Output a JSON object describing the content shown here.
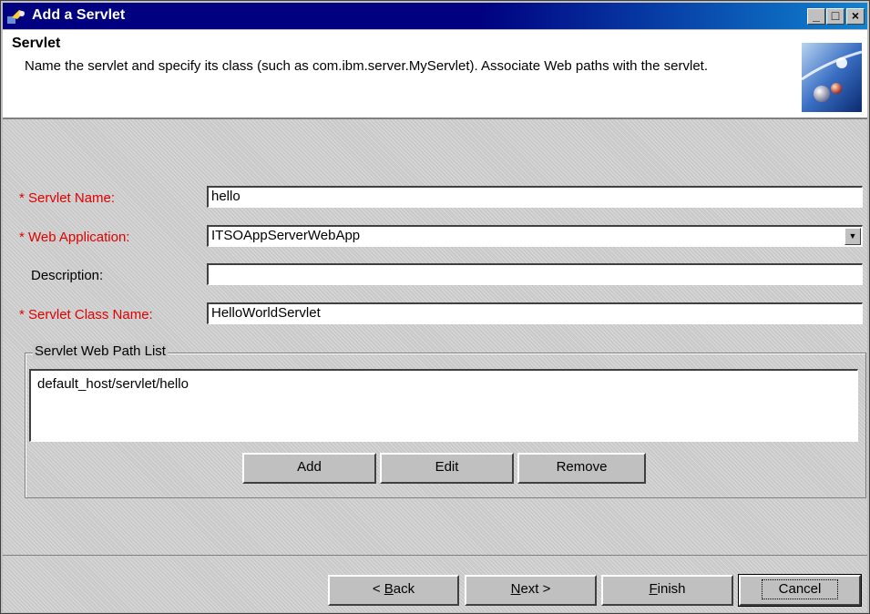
{
  "window": {
    "title": "Add a Servlet",
    "controls": {
      "minimize": "_",
      "maximize": "□",
      "close": "×"
    }
  },
  "header": {
    "title": "Servlet",
    "description": "Name the servlet and specify its class (such as com.ibm.server.MyServlet). Associate Web paths with the servlet."
  },
  "form": {
    "servlet_name": {
      "required_mark": "*",
      "label": "Servlet Name:",
      "value": "hello"
    },
    "web_application": {
      "required_mark": "*",
      "label": "Web Application:",
      "value": "ITSOAppServerWebApp"
    },
    "description": {
      "label": "Description:",
      "value": ""
    },
    "servlet_class": {
      "required_mark": "*",
      "label": "Servlet Class Name:",
      "value": "HelloWorldServlet"
    }
  },
  "web_path_list": {
    "legend": "Servlet Web Path List",
    "items": [
      "default_host/servlet/hello"
    ],
    "buttons": {
      "add": "Add",
      "edit": "Edit",
      "remove": "Remove"
    }
  },
  "footer": {
    "back": {
      "mnemonic": "B",
      "rest": "ack",
      "prefix": "< "
    },
    "next": {
      "mnemonic": "N",
      "rest": "ext",
      "suffix": " >"
    },
    "finish": {
      "mnemonic": "F",
      "rest": "inish"
    },
    "cancel": "Cancel"
  },
  "colors": {
    "required": "#e00000",
    "titlebar": "#000080",
    "dialog": "#c0c0c0"
  },
  "icons": [
    "app-icon",
    "minimize-icon",
    "maximize-icon",
    "close-icon",
    "wizard-graphic-icon",
    "dropdown-arrow-icon"
  ]
}
